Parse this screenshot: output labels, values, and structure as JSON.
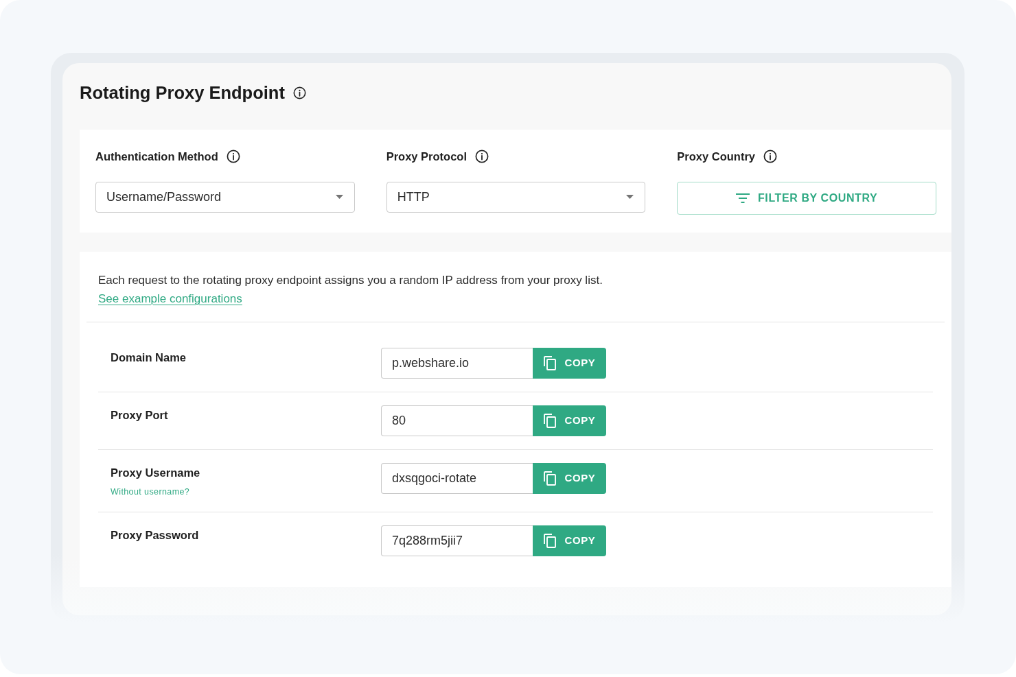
{
  "title": "Rotating Proxy Endpoint",
  "settings": [
    {
      "kind": "select",
      "label": "Authentication Method",
      "value": "Username/Password"
    },
    {
      "kind": "select",
      "label": "Proxy Protocol",
      "value": "HTTP"
    },
    {
      "kind": "button",
      "label": "Proxy Country",
      "button": "FILTER BY COUNTRY"
    }
  ],
  "description": "Each request to the rotating proxy endpoint assigns you a random IP address from your proxy list.",
  "link": "See example configurations",
  "fields": [
    {
      "label": "Domain Name",
      "value": "p.webshare.io",
      "button": "COPY"
    },
    {
      "label": "Proxy Port",
      "value": "80",
      "button": "COPY"
    },
    {
      "label": "Proxy Username",
      "hint_link": "Without username?",
      "value": "dxsqgoci-rotate",
      "button": "COPY"
    },
    {
      "label": "Proxy Password",
      "value": "7q288rm5jii7",
      "button": "COPY"
    }
  ]
}
